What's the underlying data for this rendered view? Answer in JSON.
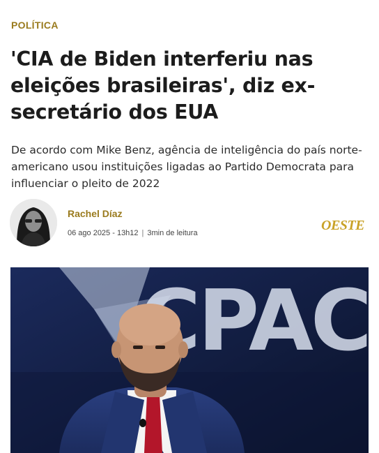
{
  "article": {
    "section": "POLÍTICA",
    "headline": "'CIA de Biden interferiu nas eleições brasileiras', diz ex-secretário dos EUA",
    "subtitle": "De acordo com Mike Benz, agência de inteligência do país norte-americano usou instituições ligadas ao Partido Democrata para influenciar o pleito de 2022"
  },
  "author": {
    "name": "Rachel Díaz",
    "date": "06 ago 2025 - 13h12",
    "separator": "|",
    "read_time": "3min de leitura"
  },
  "brand": {
    "logo_text": "OESTE",
    "color": "#c9a227"
  },
  "hero": {
    "backdrop_text": "CPAC"
  },
  "colors": {
    "accent": "#9a7b1e",
    "headline": "#1c1c1c",
    "hero_bg": "#0d1630"
  }
}
